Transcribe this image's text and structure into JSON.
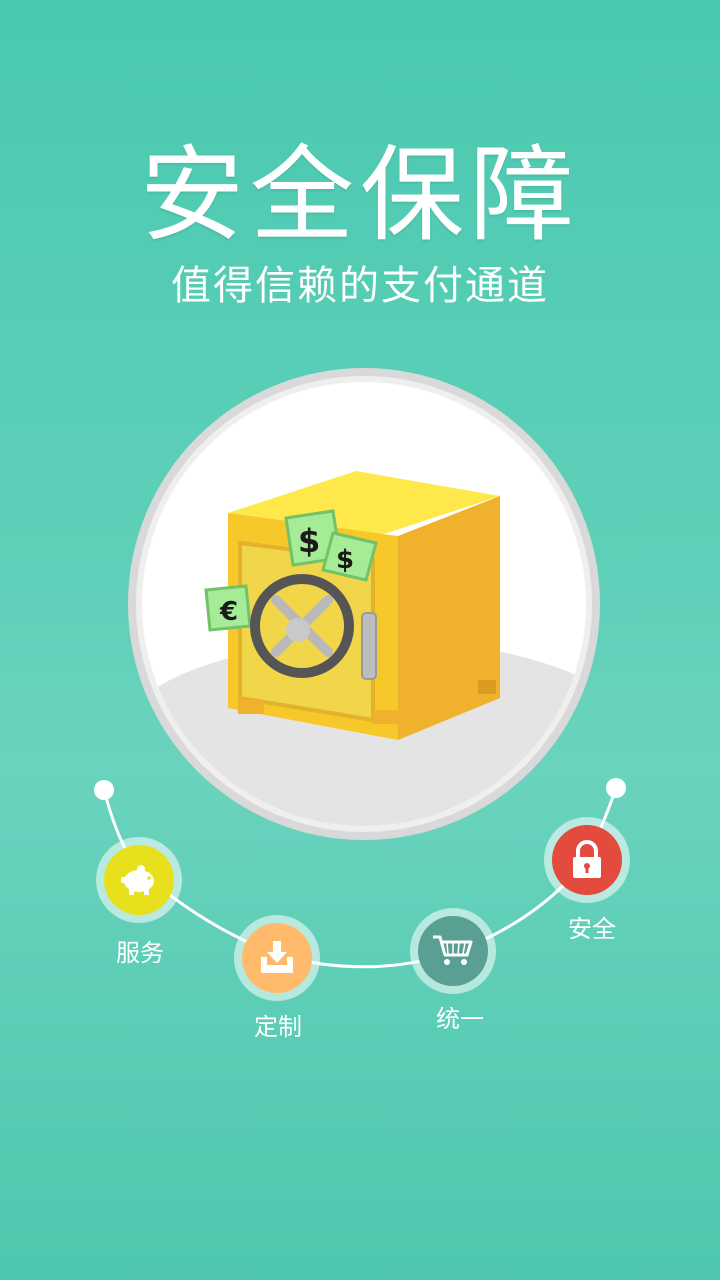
{
  "header": {
    "title": "安全保障",
    "subtitle": "值得信赖的支付通道"
  },
  "hero": {
    "icon": "safe-with-money-icon"
  },
  "features": [
    {
      "label": "服务",
      "icon": "piggy-bank-icon",
      "color": "#e8e01c"
    },
    {
      "label": "定制",
      "icon": "download-tray-icon",
      "color": "#ffbb6b"
    },
    {
      "label": "统一",
      "icon": "shopping-cart-icon",
      "color": "#5a9f94"
    },
    {
      "label": "安全",
      "icon": "lock-icon",
      "color": "#e24b3e"
    }
  ],
  "colors": {
    "background": "#4ac9b0",
    "safe_body": "#f6c829",
    "safe_top": "#ffe84a"
  }
}
